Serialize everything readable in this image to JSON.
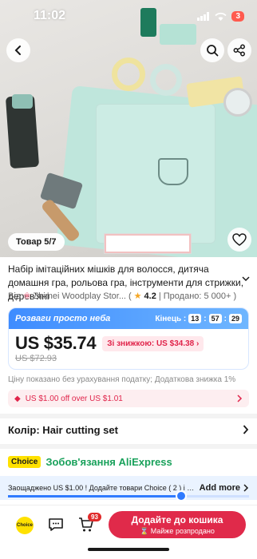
{
  "status": {
    "time": "11:02",
    "battery": "3"
  },
  "hero": {
    "photo_counter": "Товар 5/7"
  },
  "product": {
    "title": "Набір імітаційних мішків для волосся, дитяча домашня гра, рольова гра, інструменти для стрижки, дерев'яні",
    "from_label": "Від",
    "store": "Zhimei Woodplay Stor...",
    "rating": "4.2",
    "sold": "| Продано: 5 000+ )"
  },
  "promo": {
    "label": "Розваги просто неба",
    "ends_label": "Кінець :",
    "hours": "13",
    "minutes": "57",
    "seconds": "29",
    "price": "US $35.74",
    "coupon": "Зі знижкою: US $34.38 ›",
    "old_price": "US $72.93"
  },
  "tax_note": "Ціну показано без урахування податку; Додаткова знижка 1%",
  "discount": "US $1.00 off over US $1.01",
  "color_label": "Колір: Hair cutting set",
  "choice": {
    "tag": "Choice",
    "title": "Зобов'язання AliExpress"
  },
  "saved_bar": {
    "text": "Заощаджено US $1.00 ! Додайте товари Choice ( 2 ) і отрим...",
    "add_more": "Add more",
    "progress": 0.72
  },
  "bottom": {
    "choice_label": "Choice",
    "cart_count": "93",
    "buy_main": "Додайте до кошика",
    "buy_sub": "⌛ Майже розпродано"
  },
  "colors": {
    "accent": "#e02a4a",
    "promo": "#3e8cff",
    "choice_green": "#19a15b"
  }
}
